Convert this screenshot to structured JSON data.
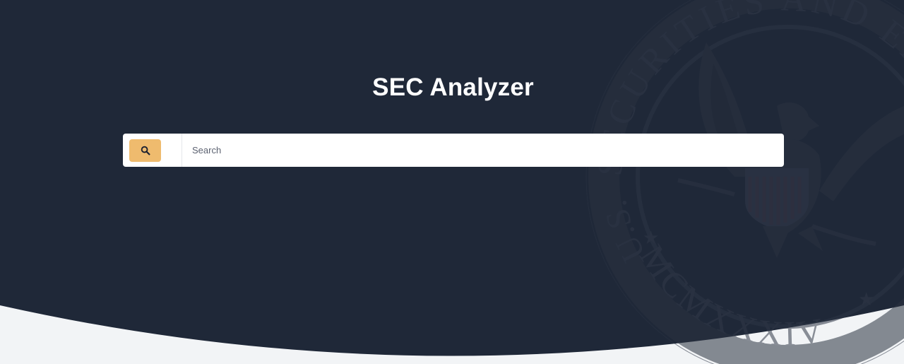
{
  "page": {
    "title": "SEC Analyzer"
  },
  "search": {
    "placeholder": "Search",
    "value": "",
    "button_icon": "search-icon"
  },
  "seal": {
    "top_text": "SECURITIES AND EXCHANGE",
    "left_text": "U.S.",
    "bottom_text": "MCMXXXIV"
  },
  "colors": {
    "hero_background": "#1f2838",
    "page_background": "#f2f4f6",
    "accent": "#efbb6e",
    "title_text": "#ffffff"
  }
}
